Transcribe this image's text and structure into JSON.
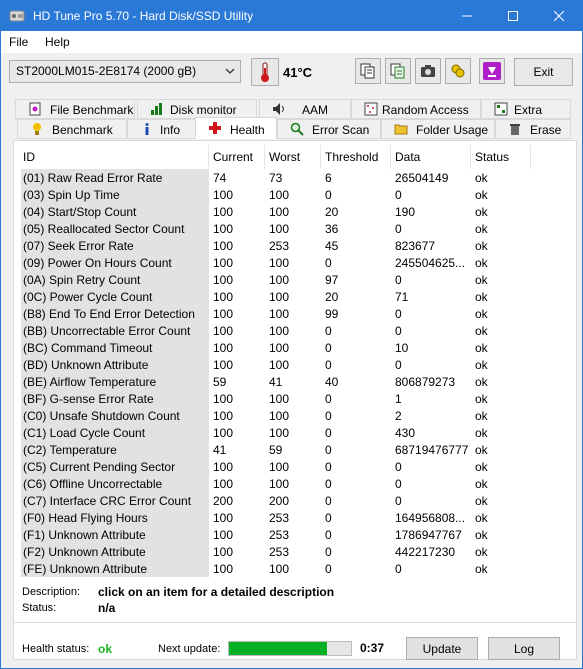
{
  "window": {
    "title": "HD Tune Pro 5.70 - Hard Disk/SSD Utility",
    "accent_color": "#2b79d7"
  },
  "menu": [
    "File",
    "Help"
  ],
  "toolbar": {
    "drive": "ST2000LM015-2E8174 (2000 gB)",
    "temperature": "41°C",
    "tool_icons": [
      "copy-text-icon",
      "copy-info-icon",
      "screenshot-icon",
      "options-icon",
      "save-icon"
    ],
    "exit_label": "Exit"
  },
  "tabs_top": [
    {
      "label": "File Benchmark",
      "icon": "file-benchmark-icon"
    },
    {
      "label": "Disk monitor",
      "icon": "disk-monitor-icon"
    },
    {
      "label": "AAM",
      "icon": "speaker-icon"
    },
    {
      "label": "Random Access",
      "icon": "random-access-icon"
    },
    {
      "label": "Extra tests",
      "icon": "extra-tests-icon"
    }
  ],
  "tabs_bottom": [
    {
      "label": "Benchmark",
      "icon": "benchmark-icon"
    },
    {
      "label": "Info",
      "icon": "info-icon"
    },
    {
      "label": "Health",
      "icon": "health-cross-icon",
      "active": true
    },
    {
      "label": "Error Scan",
      "icon": "error-scan-icon"
    },
    {
      "label": "Folder Usage",
      "icon": "folder-icon"
    },
    {
      "label": "Erase",
      "icon": "trash-icon"
    }
  ],
  "columns": [
    "ID",
    "Current",
    "Worst",
    "Threshold",
    "Data",
    "Status"
  ],
  "rows": [
    [
      "(01) Raw Read Error Rate",
      "74",
      "73",
      "6",
      "26504149",
      "ok"
    ],
    [
      "(03) Spin Up Time",
      "100",
      "100",
      "0",
      "0",
      "ok"
    ],
    [
      "(04) Start/Stop Count",
      "100",
      "100",
      "20",
      "190",
      "ok"
    ],
    [
      "(05) Reallocated Sector Count",
      "100",
      "100",
      "36",
      "0",
      "ok"
    ],
    [
      "(07) Seek Error Rate",
      "100",
      "253",
      "45",
      "823677",
      "ok"
    ],
    [
      "(09) Power On Hours Count",
      "100",
      "100",
      "0",
      "245504625...",
      "ok"
    ],
    [
      "(0A) Spin Retry Count",
      "100",
      "100",
      "97",
      "0",
      "ok"
    ],
    [
      "(0C) Power Cycle Count",
      "100",
      "100",
      "20",
      "71",
      "ok"
    ],
    [
      "(B8) End To End Error Detection",
      "100",
      "100",
      "99",
      "0",
      "ok"
    ],
    [
      "(BB) Uncorrectable Error Count",
      "100",
      "100",
      "0",
      "0",
      "ok"
    ],
    [
      "(BC) Command Timeout",
      "100",
      "100",
      "0",
      "10",
      "ok"
    ],
    [
      "(BD) Unknown Attribute",
      "100",
      "100",
      "0",
      "0",
      "ok"
    ],
    [
      "(BE) Airflow Temperature",
      "59",
      "41",
      "40",
      "806879273",
      "ok"
    ],
    [
      "(BF) G-sense Error Rate",
      "100",
      "100",
      "0",
      "1",
      "ok"
    ],
    [
      "(C0) Unsafe Shutdown Count",
      "100",
      "100",
      "0",
      "2",
      "ok"
    ],
    [
      "(C1) Load Cycle Count",
      "100",
      "100",
      "0",
      "430",
      "ok"
    ],
    [
      "(C2) Temperature",
      "41",
      "59",
      "0",
      "68719476777",
      "ok"
    ],
    [
      "(C5) Current Pending Sector",
      "100",
      "100",
      "0",
      "0",
      "ok"
    ],
    [
      "(C6) Offline Uncorrectable",
      "100",
      "100",
      "0",
      "0",
      "ok"
    ],
    [
      "(C7) Interface CRC Error Count",
      "200",
      "200",
      "0",
      "0",
      "ok"
    ],
    [
      "(F0) Head Flying Hours",
      "100",
      "253",
      "0",
      "164956808...",
      "ok"
    ],
    [
      "(F1) Unknown Attribute",
      "100",
      "253",
      "0",
      "1786947767",
      "ok"
    ],
    [
      "(F2) Unknown Attribute",
      "100",
      "253",
      "0",
      "442217230",
      "ok"
    ],
    [
      "(FE) Unknown Attribute",
      "100",
      "100",
      "0",
      "0",
      "ok"
    ]
  ],
  "description": {
    "desc_label": "Description:",
    "desc_value": "click on an item for a detailed description",
    "status_label": "Status:",
    "status_value": "n/a"
  },
  "footer": {
    "health_label": "Health status:",
    "health_value": "ok",
    "health_color": "#22b322",
    "next_update_label": "Next update:",
    "progress_fraction": 0.8,
    "countdown": "0:37",
    "update_label": "Update",
    "log_label": "Log"
  }
}
